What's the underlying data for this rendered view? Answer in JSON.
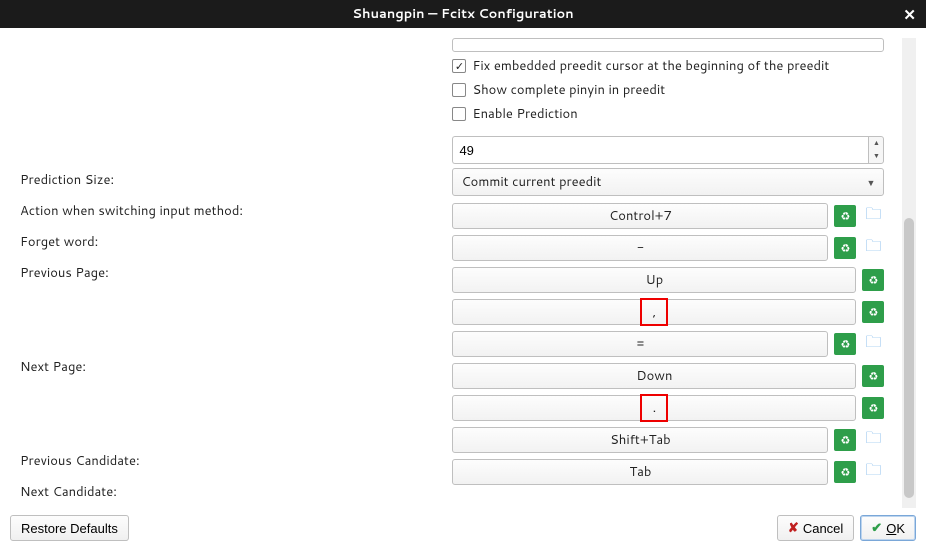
{
  "window": {
    "title": "Shuangpin — Fcitx Configuration"
  },
  "checkboxes": {
    "fix_preedit": {
      "label": "Fix embedded preedit cursor at the beginning of the preedit",
      "checked": true
    },
    "show_pinyin": {
      "label": "Show complete pinyin in preedit",
      "checked": false
    },
    "enable_prediction": {
      "label": "Enable Prediction",
      "checked": false
    }
  },
  "labels": {
    "prediction_size": "Prediction Size:",
    "switch_action": "Action when switching input method:",
    "forget_word": "Forget word:",
    "prev_page": "Previous Page:",
    "next_page": "Next Page:",
    "prev_candidate": "Previous Candidate:",
    "next_candidate": "Next Candidate:"
  },
  "prediction_size_value": "49",
  "switch_action_value": "Commit current preedit",
  "keys": {
    "forget_word": [
      "Control+7"
    ],
    "prev_page": [
      "-",
      "Up",
      ","
    ],
    "next_page": [
      "=",
      "Down",
      "."
    ],
    "prev_candidate": [
      "Shift+Tab"
    ],
    "next_candidate": [
      "Tab"
    ]
  },
  "buttons": {
    "restore": "Restore Defaults",
    "cancel": "Cancel",
    "ok_prefix": "O",
    "ok_suffix": "K"
  }
}
